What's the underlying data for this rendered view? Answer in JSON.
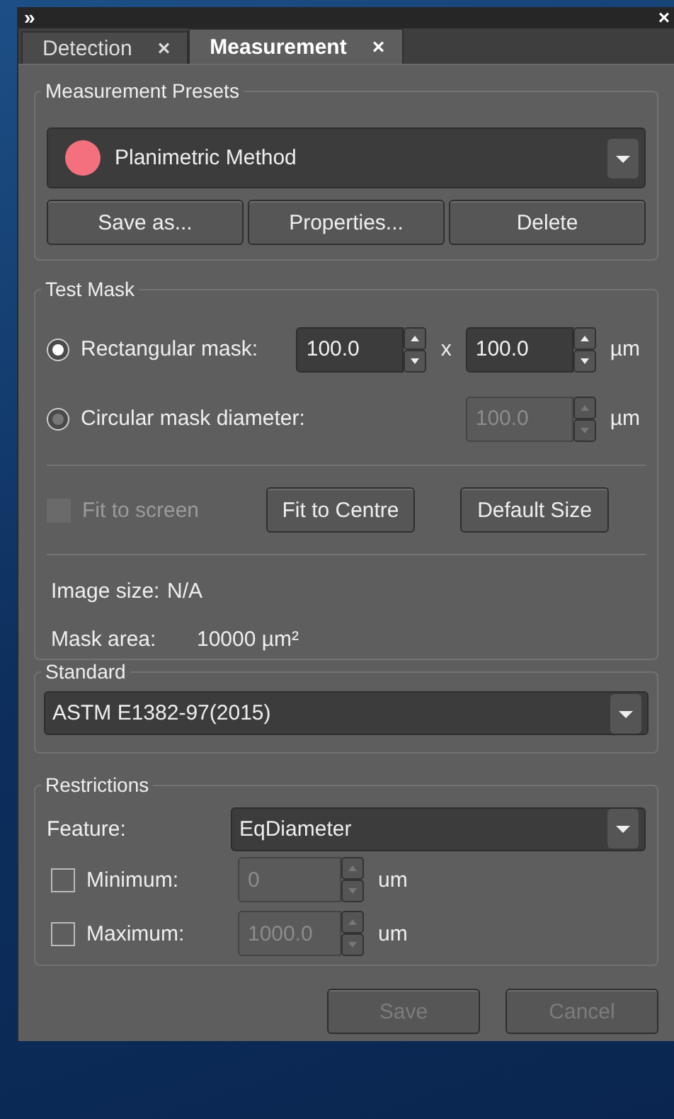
{
  "window": {
    "expand_glyph": "»",
    "close_glyph": "×"
  },
  "tabs": [
    {
      "label": "Detection",
      "close": "×",
      "selected": false
    },
    {
      "label": "Measurement",
      "close": "×",
      "selected": true
    }
  ],
  "presets": {
    "title": "Measurement Presets",
    "preset": {
      "label": "Planimetric Method",
      "color": "#f5707e"
    },
    "buttons": [
      "Save as...",
      "Properties...",
      "Delete"
    ]
  },
  "test_mask": {
    "title": "Test Mask",
    "options": [
      {
        "label": "Rectangular mask:",
        "selected": true,
        "disabled": false,
        "values": [
          "100.0",
          "100.0"
        ],
        "separator": "x",
        "unit": "µm"
      },
      {
        "label": "Circular mask diameter:",
        "selected": false,
        "disabled": true,
        "values": [
          "100.0"
        ],
        "unit": "µm"
      }
    ],
    "fit_to_screen": {
      "label": "Fit to screen",
      "checked": false,
      "disabled": true
    },
    "buttons": [
      "Fit to Centre",
      "Default Size"
    ],
    "info": [
      {
        "label": "Image size:",
        "value": "N/A"
      },
      {
        "label": "Mask area:",
        "value": "10000  µm²"
      }
    ]
  },
  "standard": {
    "title": "Standard",
    "value": "ASTM E1382-97(2015)"
  },
  "restrictions": {
    "title": "Restrictions",
    "feature_label": "Feature:",
    "feature_value": "EqDiameter",
    "limits": [
      {
        "label": "Minimum:",
        "checked": false,
        "disabled": true,
        "value": "0",
        "unit": "um"
      },
      {
        "label": "Maximum:",
        "checked": false,
        "disabled": true,
        "value": "1000.0",
        "unit": "um"
      }
    ]
  },
  "footer_buttons": [
    {
      "label": "Save",
      "disabled": true
    },
    {
      "label": "Cancel",
      "disabled": true
    }
  ]
}
